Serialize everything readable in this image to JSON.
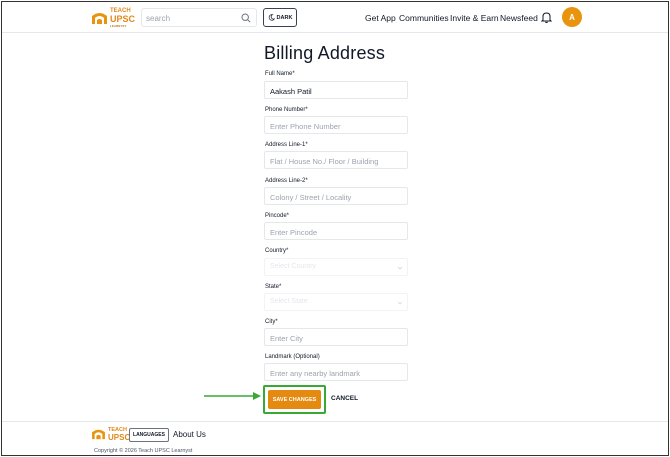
{
  "header": {
    "logo": {
      "line1": "TEACH",
      "line2": "UPSC",
      "line3": "LEARNYST"
    },
    "search": {
      "placeholder": "search"
    },
    "theme_toggle": {
      "label": "DARK"
    },
    "nav": [
      {
        "label": "Get App"
      },
      {
        "label": "Communities"
      },
      {
        "label": "Invite & Earn"
      },
      {
        "label": "Newsfeed"
      }
    ],
    "avatar_initial": "A"
  },
  "form": {
    "title": "Billing Address",
    "fields": [
      {
        "label": "Full Name*",
        "value": "Aakash Patil",
        "placeholder": ""
      },
      {
        "label": "Phone Number*",
        "value": "",
        "placeholder": "Enter Phone Number"
      },
      {
        "label": "Address Line-1*",
        "value": "",
        "placeholder": "Flat / House No./ Floor / Building"
      },
      {
        "label": "Address Line-2*",
        "value": "",
        "placeholder": "Colony / Street / Locality"
      },
      {
        "label": "Pincode*",
        "value": "",
        "placeholder": "Enter Pincode"
      },
      {
        "label": "Country*",
        "selected": "Select Country"
      },
      {
        "label": "State*",
        "selected": "Select State"
      },
      {
        "label": "City*",
        "value": "",
        "placeholder": "Enter City"
      },
      {
        "label": "Landmark (Optional)",
        "value": "",
        "placeholder": "Enter any nearby landmark"
      }
    ],
    "save_label": "SAVE CHANGES",
    "cancel_label": "CANCEL"
  },
  "footer": {
    "logo": {
      "line1": "TEACH",
      "line2": "UPSC"
    },
    "languages_label": "LANGUAGES",
    "about_label": "About Us",
    "copyright": "Copyright © 2026 Teach UPSC Learnyst"
  },
  "colors": {
    "brand": "#e58a10",
    "highlight": "#3aa835",
    "text": "#111827",
    "placeholder": "#9ca3af"
  },
  "icons": [
    "search-icon",
    "moon-icon",
    "bell-icon",
    "chevron-down-icon",
    "arrow-right-icon",
    "logo-icon"
  ]
}
